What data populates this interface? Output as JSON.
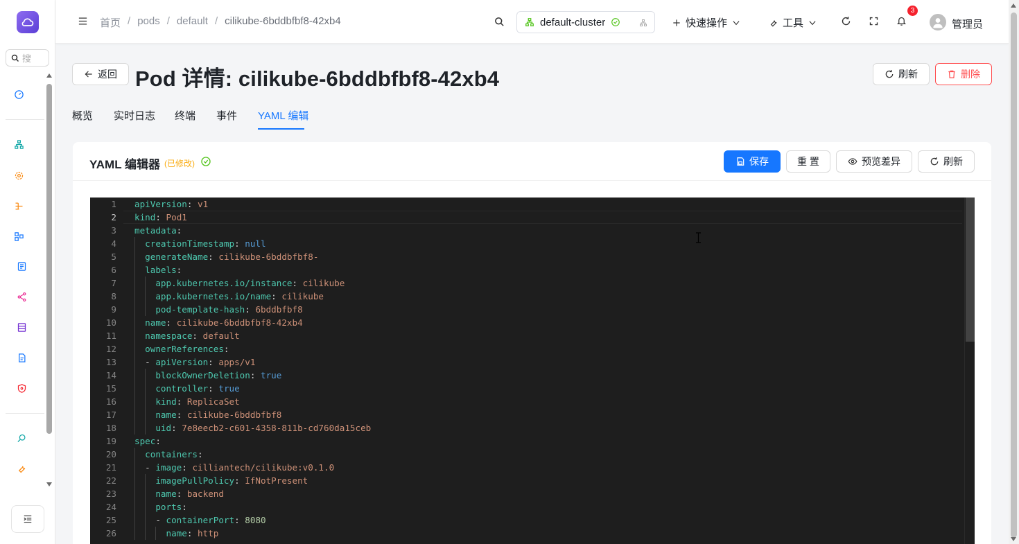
{
  "sidebar": {
    "search_placeholder": "搜",
    "icons": [
      "dashboard-icon",
      "cluster-icon",
      "settings-icon",
      "workflow-icon",
      "nodes-icon",
      "document-icon",
      "share-icon",
      "storage-icon",
      "file-icon",
      "security-icon",
      "inspect-icon",
      "tool-icon"
    ]
  },
  "header": {
    "breadcrumb": [
      "首页",
      "pods",
      "default",
      "cilikube-6bddbfbf8-42xb4"
    ],
    "cluster": "default-cluster",
    "quick_actions": "快速操作",
    "tools": "工具",
    "notification_count": "3",
    "user": "管理员"
  },
  "page": {
    "back": "返回",
    "title": "Pod 详情: cilikube-6bddbfbf8-42xb4",
    "refresh": "刷新",
    "delete": "删除"
  },
  "tabs": [
    {
      "label": "概览",
      "active": false
    },
    {
      "label": "实时日志",
      "active": false
    },
    {
      "label": "终端",
      "active": false
    },
    {
      "label": "事件",
      "active": false
    },
    {
      "label": "YAML 编辑",
      "active": true
    }
  ],
  "editor_card": {
    "title": "YAML 编辑器",
    "modified": "(已修改)",
    "save": "保存",
    "reset": "重 置",
    "preview_diff": "预览差异",
    "refresh": "刷新"
  },
  "colors": {
    "primary": "#1677ff",
    "danger": "#ff4d4f",
    "warning": "#faad14",
    "success": "#52c41a",
    "editor_bg": "#1e1e1e"
  },
  "yaml": {
    "current_line": 2,
    "lines": [
      {
        "n": "1",
        "indent": 0,
        "key": "apiVersion",
        "value": "v1",
        "vtype": "s"
      },
      {
        "n": "2",
        "indent": 0,
        "key": "kind",
        "value": "Pod1",
        "vtype": "s"
      },
      {
        "n": "3",
        "indent": 0,
        "key": "metadata",
        "value": "",
        "vtype": "s"
      },
      {
        "n": "4",
        "indent": 1,
        "key": "creationTimestamp",
        "value": "null",
        "vtype": "b"
      },
      {
        "n": "5",
        "indent": 1,
        "key": "generateName",
        "value": "cilikube-6bddbfbf8-",
        "vtype": "s"
      },
      {
        "n": "6",
        "indent": 1,
        "key": "labels",
        "value": "",
        "vtype": "s"
      },
      {
        "n": "7",
        "indent": 2,
        "key": "app.kubernetes.io/instance",
        "value": "cilikube",
        "vtype": "s"
      },
      {
        "n": "8",
        "indent": 2,
        "key": "app.kubernetes.io/name",
        "value": "cilikube",
        "vtype": "s"
      },
      {
        "n": "9",
        "indent": 2,
        "key": "pod-template-hash",
        "value": "6bddbfbf8",
        "vtype": "s"
      },
      {
        "n": "10",
        "indent": 1,
        "key": "name",
        "value": "cilikube-6bddbfbf8-42xb4",
        "vtype": "s"
      },
      {
        "n": "11",
        "indent": 1,
        "key": "namespace",
        "value": "default",
        "vtype": "s"
      },
      {
        "n": "12",
        "indent": 1,
        "key": "ownerReferences",
        "value": "",
        "vtype": "s"
      },
      {
        "n": "13",
        "indent": 1,
        "dash": true,
        "key": "apiVersion",
        "value": "apps/v1",
        "vtype": "s"
      },
      {
        "n": "14",
        "indent": 2,
        "key": "blockOwnerDeletion",
        "value": "true",
        "vtype": "b"
      },
      {
        "n": "15",
        "indent": 2,
        "key": "controller",
        "value": "true",
        "vtype": "b"
      },
      {
        "n": "16",
        "indent": 2,
        "key": "kind",
        "value": "ReplicaSet",
        "vtype": "s"
      },
      {
        "n": "17",
        "indent": 2,
        "key": "name",
        "value": "cilikube-6bddbfbf8",
        "vtype": "s"
      },
      {
        "n": "18",
        "indent": 2,
        "key": "uid",
        "value": "7e8eecb2-c601-4358-811b-cd760da15ceb",
        "vtype": "s"
      },
      {
        "n": "19",
        "indent": 0,
        "key": "spec",
        "value": "",
        "vtype": "s"
      },
      {
        "n": "20",
        "indent": 1,
        "key": "containers",
        "value": "",
        "vtype": "s"
      },
      {
        "n": "21",
        "indent": 1,
        "dash": true,
        "key": "image",
        "value": "cilliantech/cilikube:v0.1.0",
        "vtype": "s"
      },
      {
        "n": "22",
        "indent": 2,
        "key": "imagePullPolicy",
        "value": "IfNotPresent",
        "vtype": "s"
      },
      {
        "n": "23",
        "indent": 2,
        "key": "name",
        "value": "backend",
        "vtype": "s"
      },
      {
        "n": "24",
        "indent": 2,
        "key": "ports",
        "value": "",
        "vtype": "s"
      },
      {
        "n": "25",
        "indent": 2,
        "dash": true,
        "key": "containerPort",
        "value": "8080",
        "vtype": "n"
      },
      {
        "n": "26",
        "indent": 3,
        "key": "name",
        "value": "http",
        "vtype": "s"
      }
    ]
  }
}
